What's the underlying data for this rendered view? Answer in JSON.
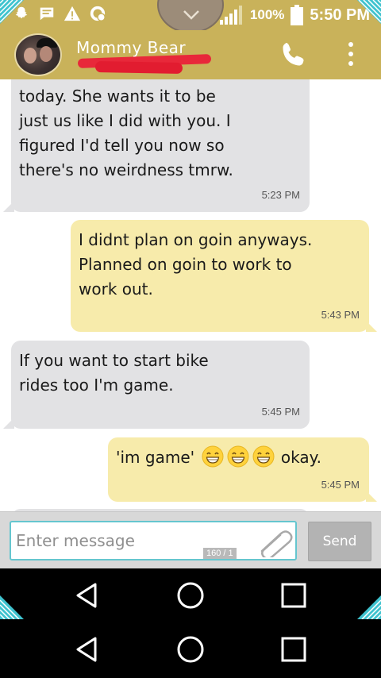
{
  "status_bar": {
    "battery_percent": "100%",
    "time": "5:50 PM",
    "icons": [
      "snapchat-icon",
      "message-icon",
      "warning-icon",
      "whatsapp-icon",
      "signal-icon",
      "battery-icon"
    ]
  },
  "header": {
    "contact_name": "Mommy Bear",
    "icons": [
      "avatar",
      "phone-icon",
      "overflow-menu-icon"
    ]
  },
  "messages": [
    {
      "direction": "incoming",
      "text": "today. She wants it to be\njust us like I did with you. I\nfigured I'd tell you now so\nthere's no weirdness tmrw.",
      "time": "5:23 PM"
    },
    {
      "direction": "outgoing",
      "text": "I didnt plan on goin anyways.\nPlanned on goin to work to\nwork out.",
      "time": "5:43 PM"
    },
    {
      "direction": "incoming",
      "text": "If you want to start bike\nrides too I'm game.",
      "time": "5:45 PM"
    },
    {
      "direction": "outgoing",
      "text_before": "'im game'",
      "emoji_count": 3,
      "emoji": "grinning-face",
      "text_after": "okay.",
      "time": "5:45 PM"
    }
  ],
  "composer": {
    "placeholder": "Enter message",
    "counter": "160 / 1",
    "send_label": "Send"
  },
  "colors": {
    "accent": "#c9b25a",
    "incoming_bubble": "#e2e2e4",
    "outgoing_bubble": "#f7ebab",
    "input_border": "#65c6cf",
    "corner_accent": "#3fc3cf"
  }
}
